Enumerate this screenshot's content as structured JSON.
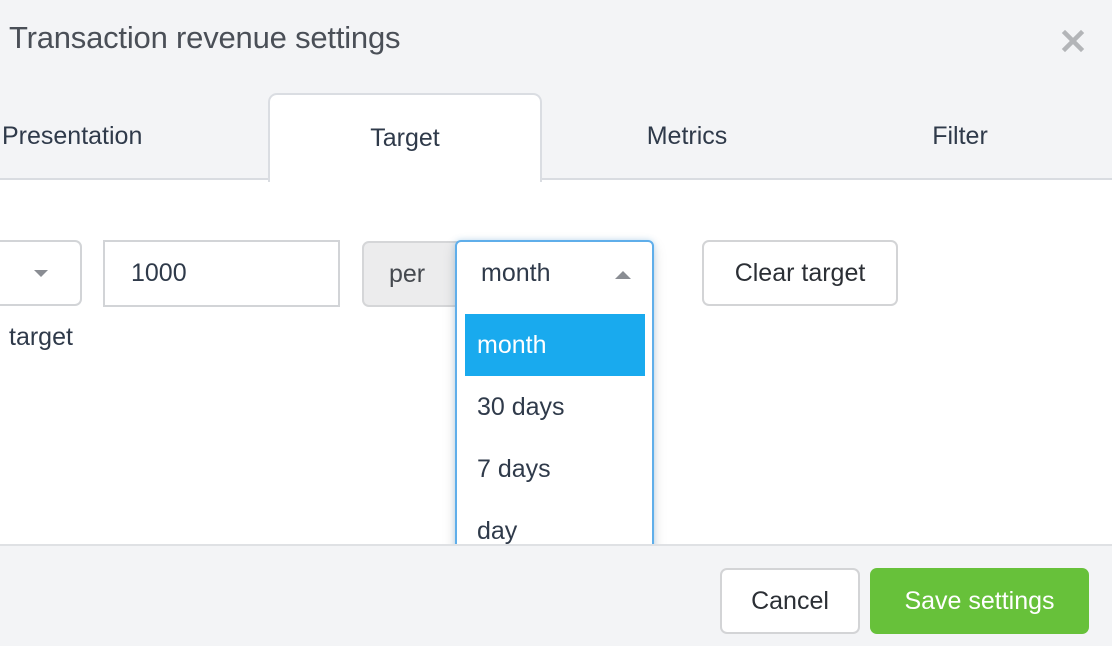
{
  "dialog": {
    "title": "Transaction revenue settings",
    "close_icon": "close-x-icon"
  },
  "tabs": [
    {
      "label": "Presentation",
      "active": false
    },
    {
      "label": "Target",
      "active": true
    },
    {
      "label": "Metrics",
      "active": false
    },
    {
      "label": "Filter",
      "active": false
    }
  ],
  "target_form": {
    "type_select_icon": "caret-down-icon",
    "value_input": "1000",
    "hint_text": "target",
    "per_label": "per",
    "period_select": {
      "current": "month",
      "open": true,
      "caret_icon": "caret-up-icon",
      "options": [
        {
          "label": "month",
          "selected": true
        },
        {
          "label": "30 days",
          "selected": false
        },
        {
          "label": "7 days",
          "selected": false
        },
        {
          "label": "day",
          "selected": false
        }
      ],
      "highlight_color": "#19aaee"
    },
    "clear_button": "Clear target"
  },
  "footer": {
    "cancel_label": "Cancel",
    "save_label": "Save settings",
    "save_color": "#67c13a"
  }
}
